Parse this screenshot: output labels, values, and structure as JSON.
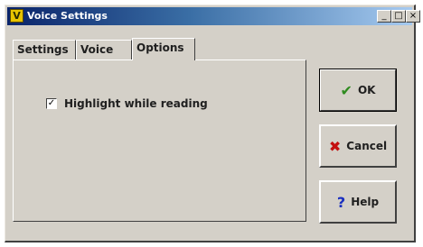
{
  "window": {
    "title": "Voice Settings",
    "controls": {
      "minimize": "_",
      "maximize": "□",
      "close": "×"
    }
  },
  "tabs": [
    {
      "label": "Settings",
      "active": false
    },
    {
      "label": "Voice",
      "active": false
    },
    {
      "label": "Options",
      "active": true
    }
  ],
  "options": {
    "highlight_label": "Highlight while reading",
    "highlight_checked": true
  },
  "buttons": {
    "ok": "OK",
    "cancel": "Cancel",
    "help": "Help"
  },
  "colors": {
    "titlebar_start": "#0a246a",
    "titlebar_end": "#a6caf0",
    "face": "#d4d0c8",
    "ok_icon": "#2e8b1f",
    "cancel_icon": "#c41010",
    "help_icon": "#1a2fbf"
  },
  "icons": {
    "app": "voice-settings-app-icon",
    "ok": "checkmark-icon",
    "cancel": "x-icon",
    "help": "question-mark-icon"
  }
}
